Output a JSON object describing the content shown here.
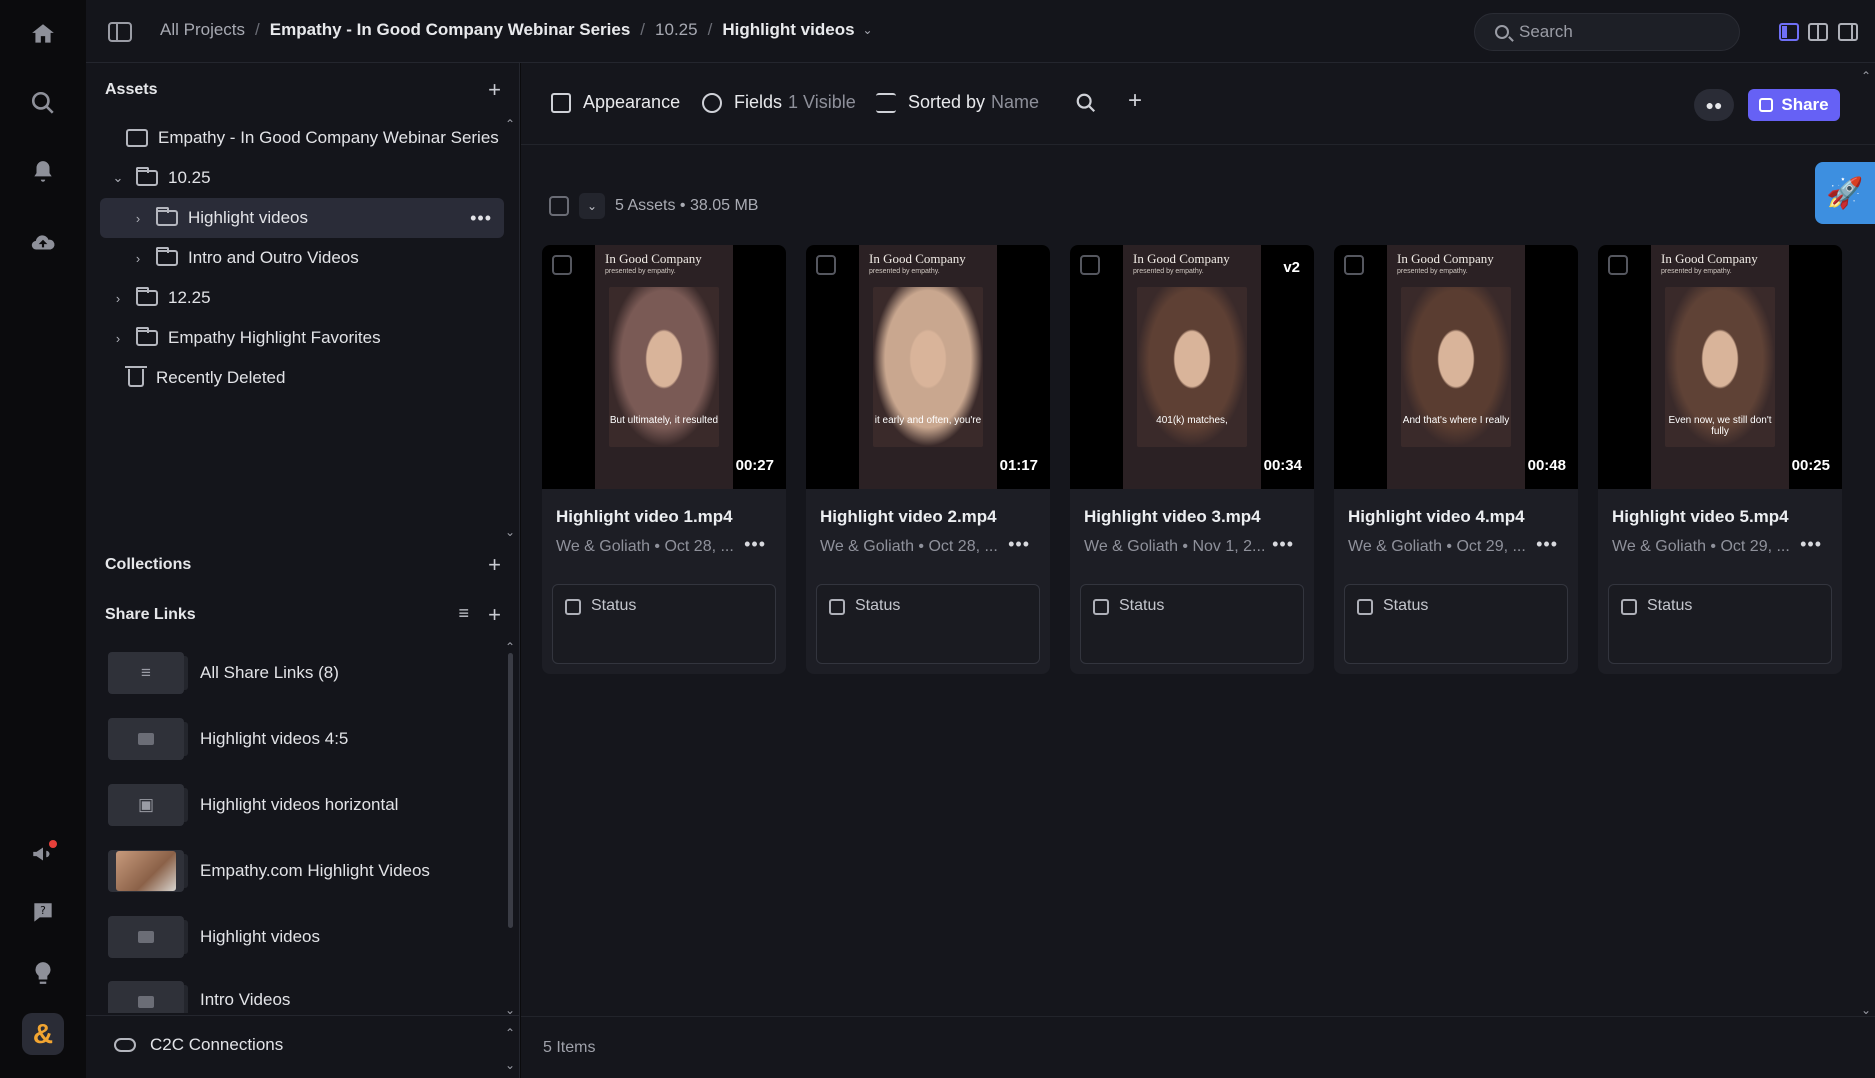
{
  "breadcrumb": {
    "root": "All Projects",
    "project": "Empathy - In Good Company Webinar Series",
    "folder": "10.25",
    "current": "Highlight videos"
  },
  "search": {
    "placeholder": "Search"
  },
  "sidebar": {
    "assets_heading": "Assets",
    "tree": [
      {
        "label": "Empathy - In Good Company Webinar Series",
        "type": "project"
      },
      {
        "label": "10.25",
        "type": "folder",
        "expanded": true
      },
      {
        "label": "Highlight videos",
        "type": "folder",
        "selected": true
      },
      {
        "label": "Intro and Outro Videos",
        "type": "folder"
      },
      {
        "label": "12.25",
        "type": "folder"
      },
      {
        "label": "Empathy Highlight Favorites",
        "type": "folder"
      },
      {
        "label": "Recently Deleted",
        "type": "trash"
      }
    ],
    "collections_heading": "Collections",
    "share_links_heading": "Share Links",
    "share_links": [
      {
        "label": "All Share Links (8)",
        "icon": "list-icon"
      },
      {
        "label": "Highlight videos 4:5",
        "icon": "folder-icon"
      },
      {
        "label": "Highlight videos horizontal",
        "icon": "share-icon"
      },
      {
        "label": "Empathy.com Highlight Videos",
        "icon": "video-thumbnail"
      },
      {
        "label": "Highlight videos",
        "icon": "folder-icon"
      },
      {
        "label": "Intro Videos",
        "icon": "folder-icon"
      }
    ],
    "c2c_label": "C2C Connections"
  },
  "toolbar": {
    "appearance": "Appearance",
    "fields": "Fields",
    "fields_count": "1 Visible",
    "sorted_by": "Sorted by",
    "sort_value": "Name",
    "share": "Share"
  },
  "summary": "5 Assets • 38.05 MB",
  "assets": [
    {
      "title": "Highlight video 1.mp4",
      "meta": "We & Goliath • Oct 28, ...",
      "duration": "00:27",
      "version": "",
      "brand": "In Good Company",
      "brand_sub": "presented by empathy.",
      "caption": "But ultimately, it resulted",
      "status": "Status",
      "tone": "#7a5a55"
    },
    {
      "title": "Highlight video 2.mp4",
      "meta": "We & Goliath • Oct 28, ...",
      "duration": "01:17",
      "version": "",
      "brand": "In Good Company",
      "brand_sub": "presented by empathy.",
      "caption": "it early and often, you're",
      "status": "Status",
      "tone": "#c9a78f"
    },
    {
      "title": "Highlight video 3.mp4",
      "meta": "We & Goliath • Nov 1, 2...",
      "duration": "00:34",
      "version": "v2",
      "brand": "In Good Company",
      "brand_sub": "presented by empathy.",
      "caption": "401(k) matches,",
      "status": "Status",
      "tone": "#5e4034"
    },
    {
      "title": "Highlight video 4.mp4",
      "meta": "We & Goliath • Oct 29, ...",
      "duration": "00:48",
      "version": "",
      "brand": "In Good Company",
      "brand_sub": "presented by empathy.",
      "caption": "And that's where I really",
      "status": "Status",
      "tone": "#5a3d31"
    },
    {
      "title": "Highlight video 5.mp4",
      "meta": "We & Goliath • Oct 29, ...",
      "duration": "00:25",
      "version": "",
      "brand": "In Good Company",
      "brand_sub": "presented by empathy.",
      "caption": "Even now, we still don't fully",
      "status": "Status",
      "tone": "#5f4236"
    }
  ],
  "footer": {
    "items": "5 Items"
  }
}
